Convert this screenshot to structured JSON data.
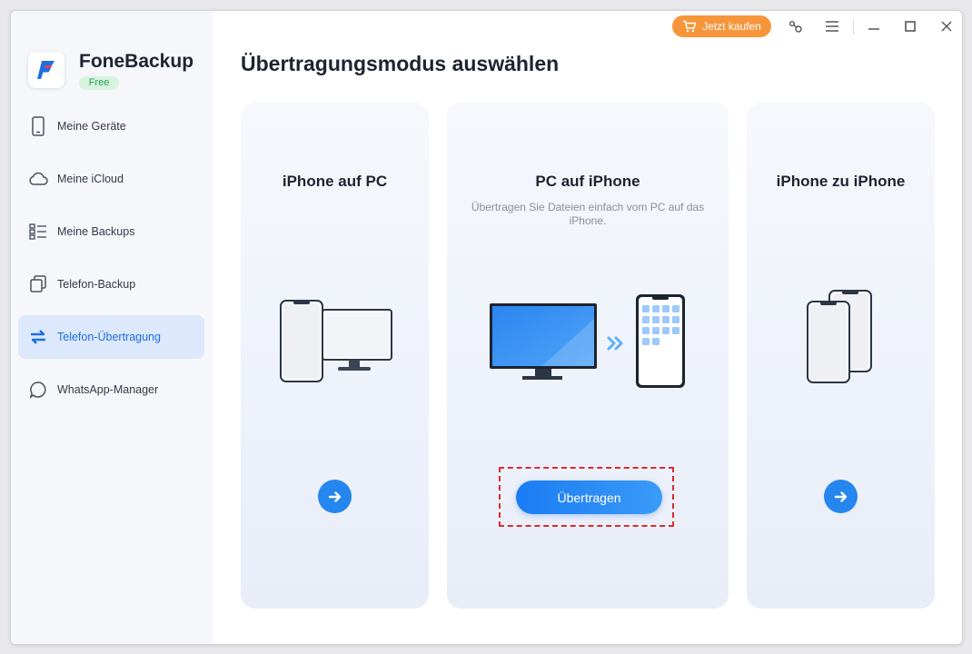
{
  "app": {
    "name": "FoneBackup",
    "edition": "Free"
  },
  "topbar": {
    "buy_label": "Jetzt kaufen"
  },
  "sidebar": {
    "items": [
      {
        "label": "Meine Geräte",
        "icon": "phone-icon"
      },
      {
        "label": "Meine iCloud",
        "icon": "cloud-icon"
      },
      {
        "label": "Meine Backups",
        "icon": "list-icon"
      },
      {
        "label": "Telefon-Backup",
        "icon": "copy-icon"
      },
      {
        "label": "Telefon-Übertragung",
        "icon": "transfer-icon",
        "active": true
      },
      {
        "label": "WhatsApp-Manager",
        "icon": "chat-icon"
      }
    ]
  },
  "main": {
    "title": "Übertragungsmodus auswählen",
    "cards": [
      {
        "title": "iPhone auf PC"
      },
      {
        "title": "PC auf iPhone",
        "description": "Übertragen Sie Dateien einfach vom PC auf das iPhone.",
        "button": "Übertragen"
      },
      {
        "title": "iPhone zu iPhone"
      }
    ]
  },
  "colors": {
    "accent": "#2686ef",
    "buy": "#f7953a",
    "active_bg": "#dce8fb",
    "highlight": "#d72d2d"
  }
}
